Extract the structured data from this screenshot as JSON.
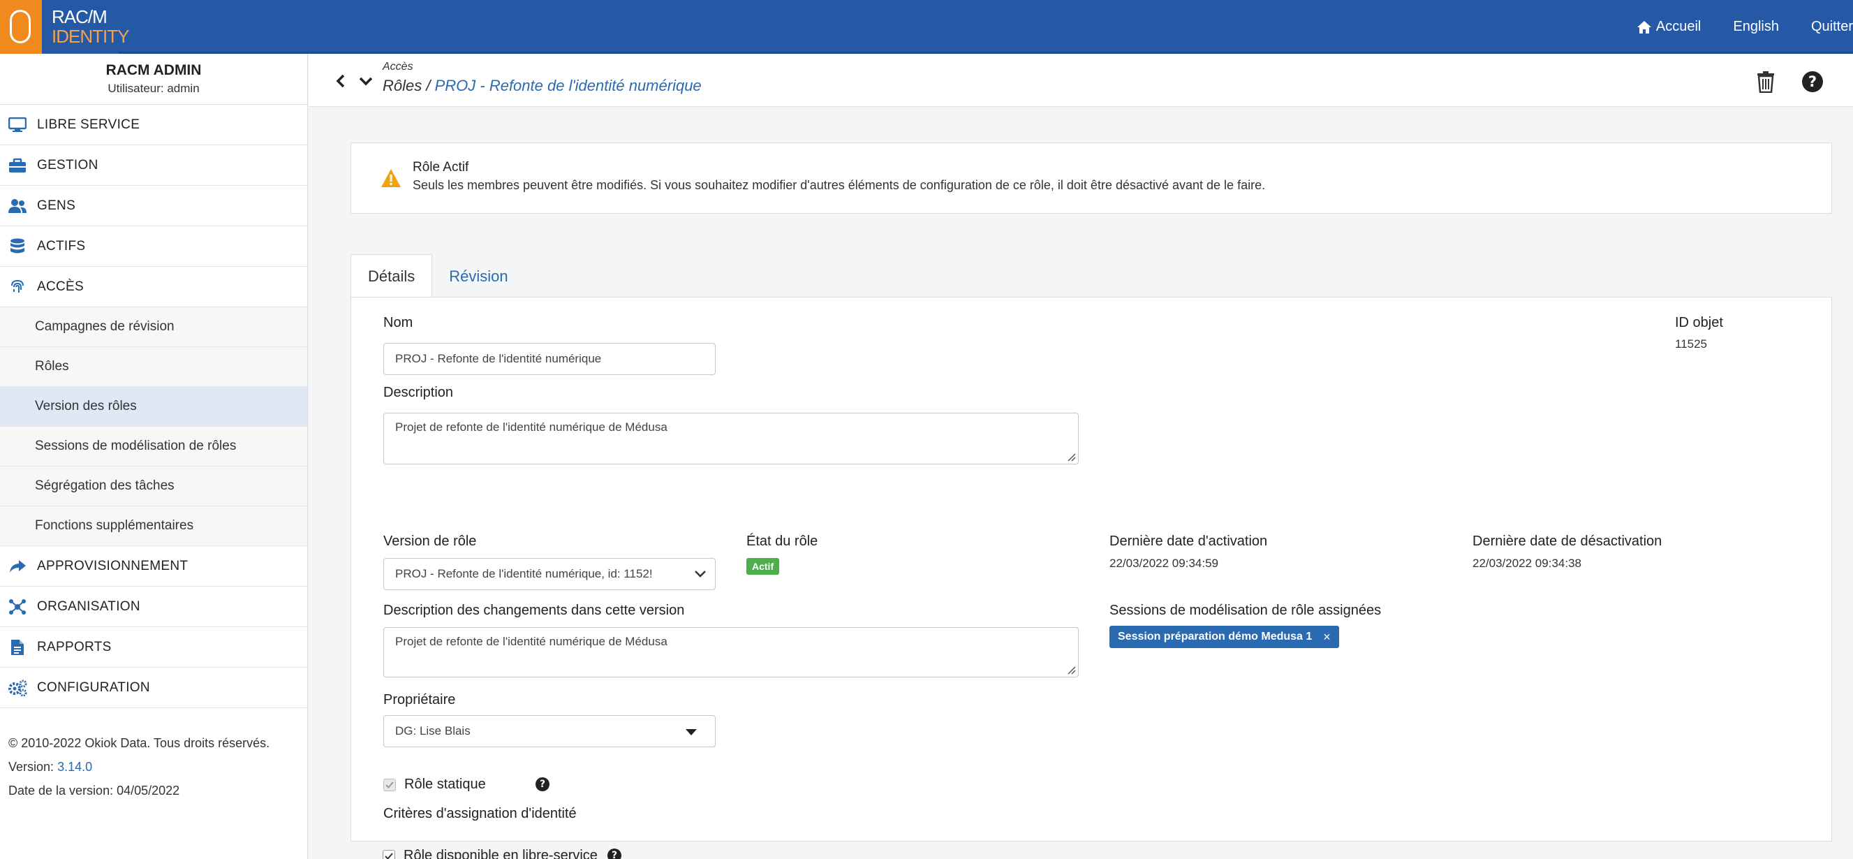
{
  "topbar": {
    "logo_line1": "RAC/M",
    "logo_line2": "IDENTITY",
    "nav": {
      "home": "Accueil",
      "language": "English",
      "quit": "Quitter"
    }
  },
  "sidebar": {
    "admin_title": "RACM ADMIN",
    "admin_user": "Utilisateur: admin",
    "menu": {
      "libre_service": "LIBRE SERVICE",
      "gestion": "GESTION",
      "gens": "GENS",
      "actifs": "ACTIFS",
      "acces": "ACCÈS",
      "approvisionnement": "APPROVISIONNEMENT",
      "organisation": "ORGANISATION",
      "rapports": "RAPPORTS",
      "configuration": "CONFIGURATION"
    },
    "submenu": [
      {
        "label": "Campagnes de révision"
      },
      {
        "label": "Rôles"
      },
      {
        "label": "Version des rôles"
      },
      {
        "label": "Sessions de modélisation de rôles"
      },
      {
        "label": "Ségrégation des tâches"
      },
      {
        "label": "Fonctions supplémentaires"
      }
    ],
    "footer": {
      "copyright": "© 2010-2022 Okiok Data. Tous droits réservés.",
      "version_label": "Version:",
      "version_value": "3.14.0",
      "date_label": "Date de la version: 04/05/2022"
    }
  },
  "header": {
    "crumb_small": "Accès",
    "crumb_prefix": "Rôles / ",
    "crumb_link": "PROJ - Refonte de l'identité numérique"
  },
  "alert": {
    "title": "Rôle Actif",
    "text": "Seuls les membres peuvent être modifiés. Si vous souhaitez modifier d'autres éléments de configuration de ce rôle, il doit être désactivé avant de le faire."
  },
  "tabs": {
    "details": "Détails",
    "revision": "Révision"
  },
  "form": {
    "nom_label": "Nom",
    "nom_value": "PROJ - Refonte de l'identité numérique",
    "object_id_label": "ID objet",
    "object_id_value": "11525",
    "description_label": "Description",
    "description_value": "Projet de refonte de l'identité numérique de Médusa",
    "version_label": "Version de rôle",
    "version_value": "PROJ - Refonte de l'identité numérique, id: 1152!",
    "state_label": "État du rôle",
    "state_value": "Actif",
    "last_activation_label": "Dernière date d'activation",
    "last_activation_value": "22/03/2022 09:34:59",
    "last_deactivation_label": "Dernière date de désactivation",
    "last_deactivation_value": "22/03/2022 09:34:38",
    "changes_label": "Description des changements dans cette version",
    "changes_value": "Projet de refonte de l'identité numérique de Médusa",
    "sessions_label": "Sessions de modélisation de rôle assignées",
    "session_tag": "Session préparation démo Medusa 1",
    "owner_label": "Propriétaire",
    "owner_value": "DG: Lise Blais",
    "static_role_label": "Rôle statique",
    "static_role_checked": true,
    "criteria_label": "Critères d'assignation d'identité",
    "self_service_label": "Rôle disponible en libre-service",
    "self_service_checked": true
  },
  "colors": {
    "topbar": "#2559a6",
    "accent": "#2a6ab0",
    "logo_orange": "#f08a1e",
    "active_badge": "#4cae4c",
    "warning": "#f0a30a"
  }
}
